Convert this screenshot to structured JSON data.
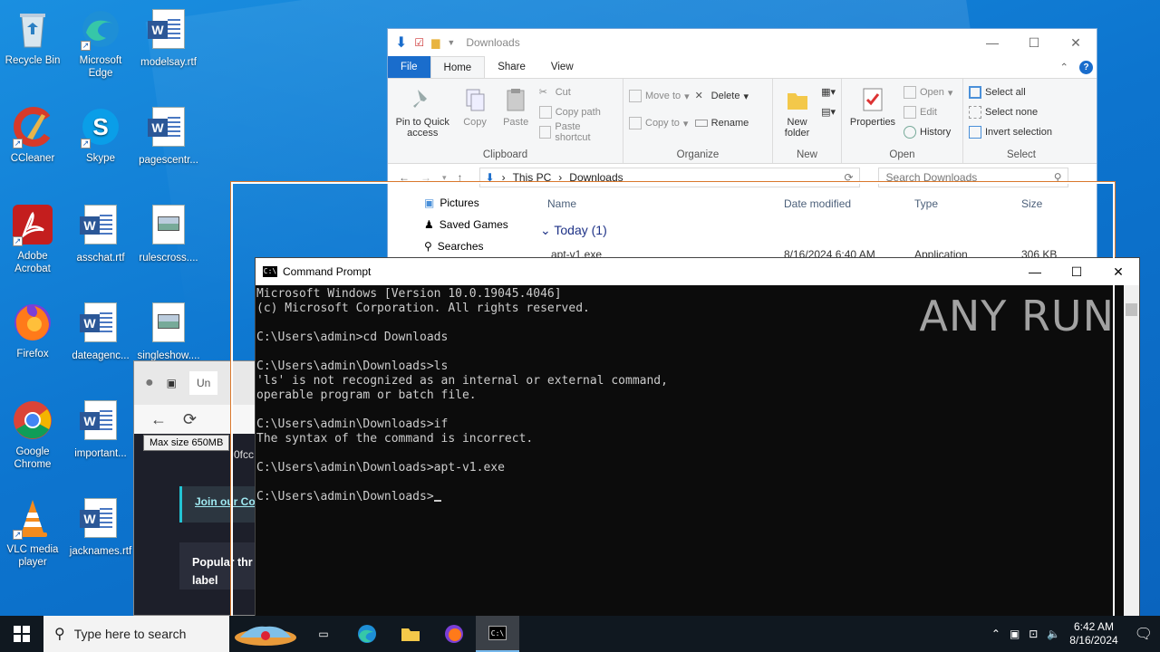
{
  "desktop": {
    "icons": [
      {
        "label": "Recycle Bin"
      },
      {
        "label": "Microsoft Edge"
      },
      {
        "label": "modelsay.rtf"
      },
      {
        "label": "CCleaner"
      },
      {
        "label": "Skype"
      },
      {
        "label": "pagescentr..."
      },
      {
        "label": "Adobe Acrobat"
      },
      {
        "label": "asschat.rtf"
      },
      {
        "label": "rulescross...."
      },
      {
        "label": "Firefox"
      },
      {
        "label": "dateagenc..."
      },
      {
        "label": "singleshow...."
      },
      {
        "label": "Google Chrome"
      },
      {
        "label": "important..."
      },
      {
        "label": "VLC media player"
      },
      {
        "label": "jacknames.rtf"
      }
    ]
  },
  "explorer": {
    "title": "Downloads",
    "tabs": [
      "File",
      "Home",
      "Share",
      "View"
    ],
    "clipboard": {
      "pin": "Pin to Quick access",
      "copy": "Copy",
      "paste": "Paste",
      "cut": "Cut",
      "copy_path": "Copy path",
      "paste_shortcut": "Paste shortcut",
      "label": "Clipboard"
    },
    "organize": {
      "move_to": "Move to",
      "copy_to": "Copy to",
      "delete": "Delete",
      "rename": "Rename",
      "label": "Organize"
    },
    "new": {
      "new_folder": "New folder",
      "label": "New"
    },
    "open": {
      "properties": "Properties",
      "open": "Open",
      "edit": "Edit",
      "history": "History",
      "label": "Open"
    },
    "select": {
      "select_all": "Select all",
      "select_none": "Select none",
      "invert": "Invert selection",
      "label": "Select"
    },
    "address": {
      "crumbs": [
        "This PC",
        "Downloads"
      ],
      "search_placeholder": "Search Downloads"
    },
    "nav": [
      "Pictures",
      "Saved Games",
      "Searches"
    ],
    "columns": [
      "Name",
      "Date modified",
      "Type",
      "Size"
    ],
    "group": "Today (1)",
    "files": [
      {
        "name": "apt-v1.exe",
        "date": "8/16/2024 6:40 AM",
        "type": "Application",
        "size": "306 KB"
      }
    ]
  },
  "browser": {
    "tab_label": "Un",
    "tooltip": "Max size 650MB",
    "url_fragment": "0fcc",
    "join": "Join our Co",
    "popular": "Popular thr label"
  },
  "cmd": {
    "title": "Command Prompt",
    "lines": [
      "Microsoft Windows [Version 10.0.19045.4046]",
      "(c) Microsoft Corporation. All rights reserved.",
      "",
      "C:\\Users\\admin>cd Downloads",
      "",
      "C:\\Users\\admin\\Downloads>ls",
      "'ls' is not recognized as an internal or external command,",
      "operable program or batch file.",
      "",
      "C:\\Users\\admin\\Downloads>if",
      "The syntax of the command is incorrect.",
      "",
      "C:\\Users\\admin\\Downloads>apt-v1.exe",
      "",
      "C:\\Users\\admin\\Downloads>"
    ],
    "watermark": "ANY RUN"
  },
  "taskbar": {
    "search_placeholder": "Type here to search",
    "time": "6:42 AM",
    "date": "8/16/2024"
  }
}
